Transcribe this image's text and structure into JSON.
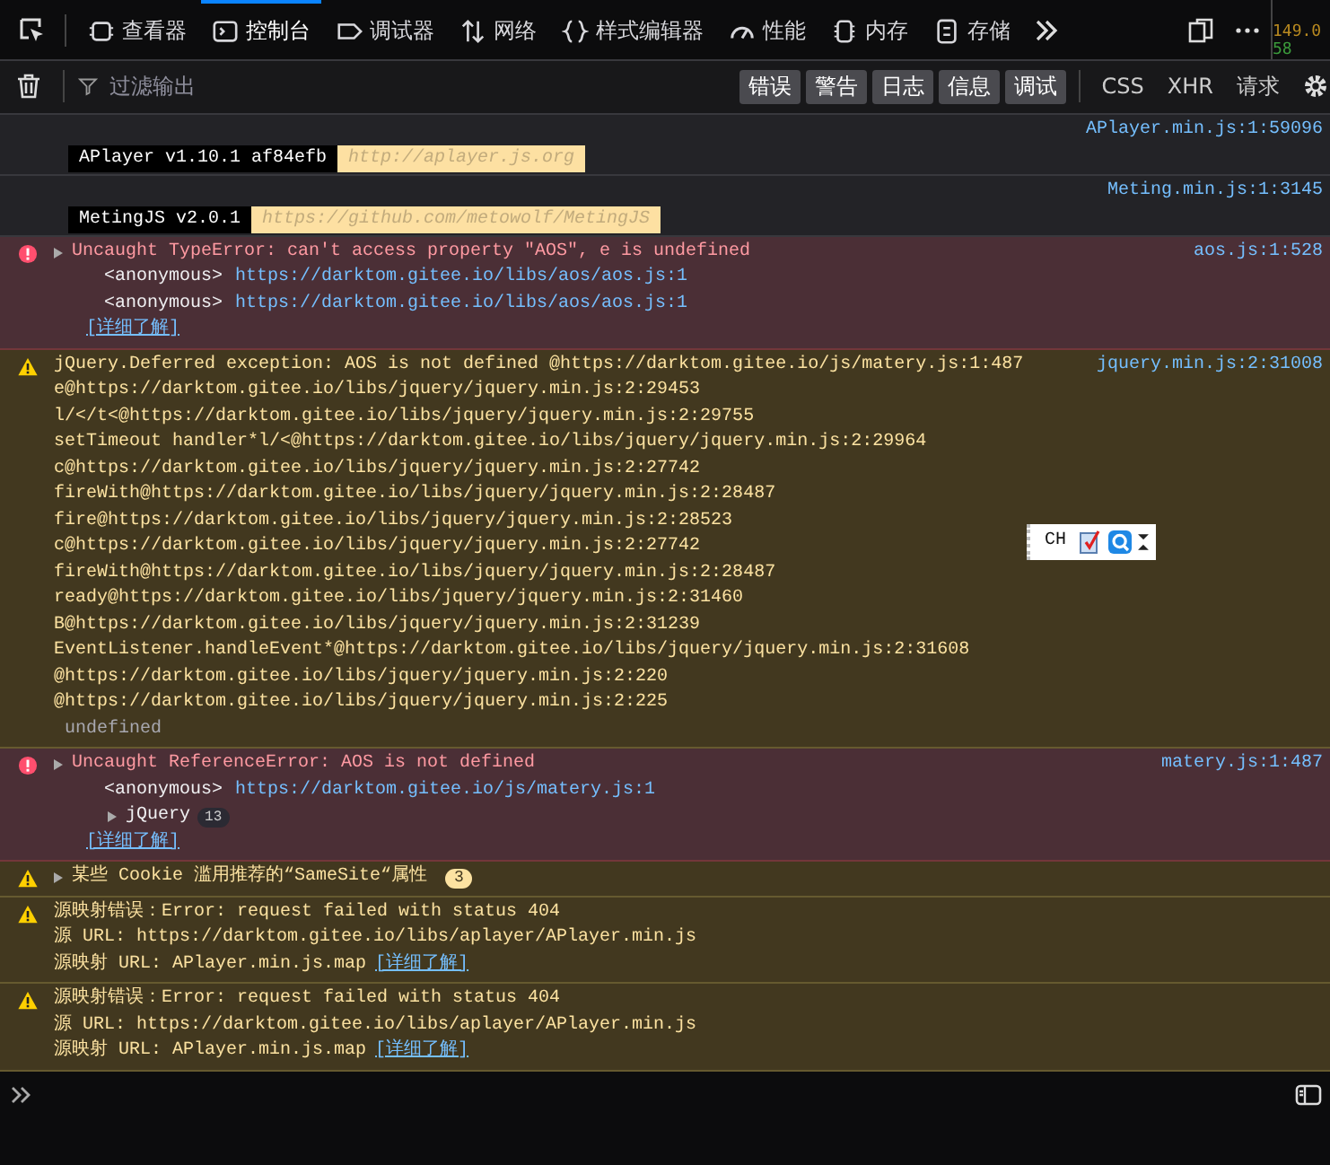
{
  "toolbar": {
    "tabs": [
      {
        "label": "查看器",
        "selected": false
      },
      {
        "label": "控制台",
        "selected": true
      },
      {
        "label": "调试器",
        "selected": false
      },
      {
        "label": "网络",
        "selected": false
      },
      {
        "label": "样式编辑器",
        "selected": false
      },
      {
        "label": "性能",
        "selected": false
      },
      {
        "label": "内存",
        "selected": false
      },
      {
        "label": "存储",
        "selected": false
      }
    ],
    "overlay_readings": [
      "149.0",
      "58"
    ]
  },
  "filter_bar": {
    "placeholder": "过滤输出",
    "levels": [
      {
        "label": "错误",
        "selected": true
      },
      {
        "label": "警告",
        "selected": true
      },
      {
        "label": "日志",
        "selected": true
      },
      {
        "label": "信息",
        "selected": true
      },
      {
        "label": "调试",
        "selected": true
      }
    ],
    "types": [
      {
        "label": "CSS",
        "selected": false
      },
      {
        "label": "XHR",
        "selected": false
      },
      {
        "label": "请求",
        "selected": false
      }
    ]
  },
  "messages": [
    {
      "kind": "log",
      "badge": "APlayer v1.10.1 af84efb",
      "link": "http://aplayer.js.org",
      "source": "APlayer.min.js:1:59096"
    },
    {
      "kind": "log",
      "badge": "MetingJS v2.0.1",
      "link": "https://github.com/metowolf/MetingJS",
      "source": "Meting.min.js:1:3145"
    },
    {
      "kind": "error",
      "expanded": false,
      "lines": [
        "Uncaught TypeError: can't access property \"AOS\", e is undefined"
      ],
      "source": "aos.js:1:528",
      "frames": [
        {
          "fn": "<anonymous>",
          "url": "https://darktom.gitee.io/libs/aos/aos.js:1"
        },
        {
          "fn": "<anonymous>",
          "url": "https://darktom.gitee.io/libs/aos/aos.js:1"
        }
      ],
      "learn_more": "[详细了解]"
    },
    {
      "kind": "warning",
      "lines": [
        "jQuery.Deferred exception: AOS is not defined @https://darktom.gitee.io/js/matery.js:1:487",
        "e@https://darktom.gitee.io/libs/jquery/jquery.min.js:2:29453",
        "l/</t<@https://darktom.gitee.io/libs/jquery/jquery.min.js:2:29755",
        "setTimeout handler*l/<@https://darktom.gitee.io/libs/jquery/jquery.min.js:2:29964",
        "c@https://darktom.gitee.io/libs/jquery/jquery.min.js:2:27742",
        "fireWith@https://darktom.gitee.io/libs/jquery/jquery.min.js:2:28487",
        "fire@https://darktom.gitee.io/libs/jquery/jquery.min.js:2:28523",
        "c@https://darktom.gitee.io/libs/jquery/jquery.min.js:2:27742",
        "fireWith@https://darktom.gitee.io/libs/jquery/jquery.min.js:2:28487",
        "ready@https://darktom.gitee.io/libs/jquery/jquery.min.js:2:31460",
        "B@https://darktom.gitee.io/libs/jquery/jquery.min.js:2:31239",
        "EventListener.handleEvent*@https://darktom.gitee.io/libs/jquery/jquery.min.js:2:31608",
        "@https://darktom.gitee.io/libs/jquery/jquery.min.js:2:220",
        "@https://darktom.gitee.io/libs/jquery/jquery.min.js:2:225"
      ],
      "result": "undefined",
      "source": "jquery.min.js:2:31008"
    },
    {
      "kind": "error",
      "expanded": false,
      "lines": [
        "Uncaught ReferenceError: AOS is not defined"
      ],
      "source": "matery.js:1:487",
      "frames": [
        {
          "fn": "<anonymous>",
          "url": "https://darktom.gitee.io/js/matery.js:1"
        }
      ],
      "groups": [
        {
          "label": "jQuery",
          "count": "13",
          "expanded": false
        }
      ],
      "learn_more": "[详细了解]"
    },
    {
      "kind": "warning",
      "expanded": false,
      "lines": [
        "某些 Cookie 滥用推荐的“SameSite“属性"
      ],
      "count": "3"
    },
    {
      "kind": "warning",
      "lines": [
        "源映射错误：Error: request failed with status 404",
        "源 URL: https://darktom.gitee.io/libs/aplayer/APlayer.min.js",
        "源映射 URL: APlayer.min.js.map"
      ],
      "learn_more": "[详细了解]"
    },
    {
      "kind": "warning",
      "lines": [
        "源映射错误：Error: request failed with status 404",
        "源 URL: https://darktom.gitee.io/libs/aplayer/APlayer.min.js",
        "源映射 URL: APlayer.min.js.map"
      ],
      "learn_more": "[详细了解]"
    }
  ],
  "ime_bar": {
    "label": "CH"
  }
}
